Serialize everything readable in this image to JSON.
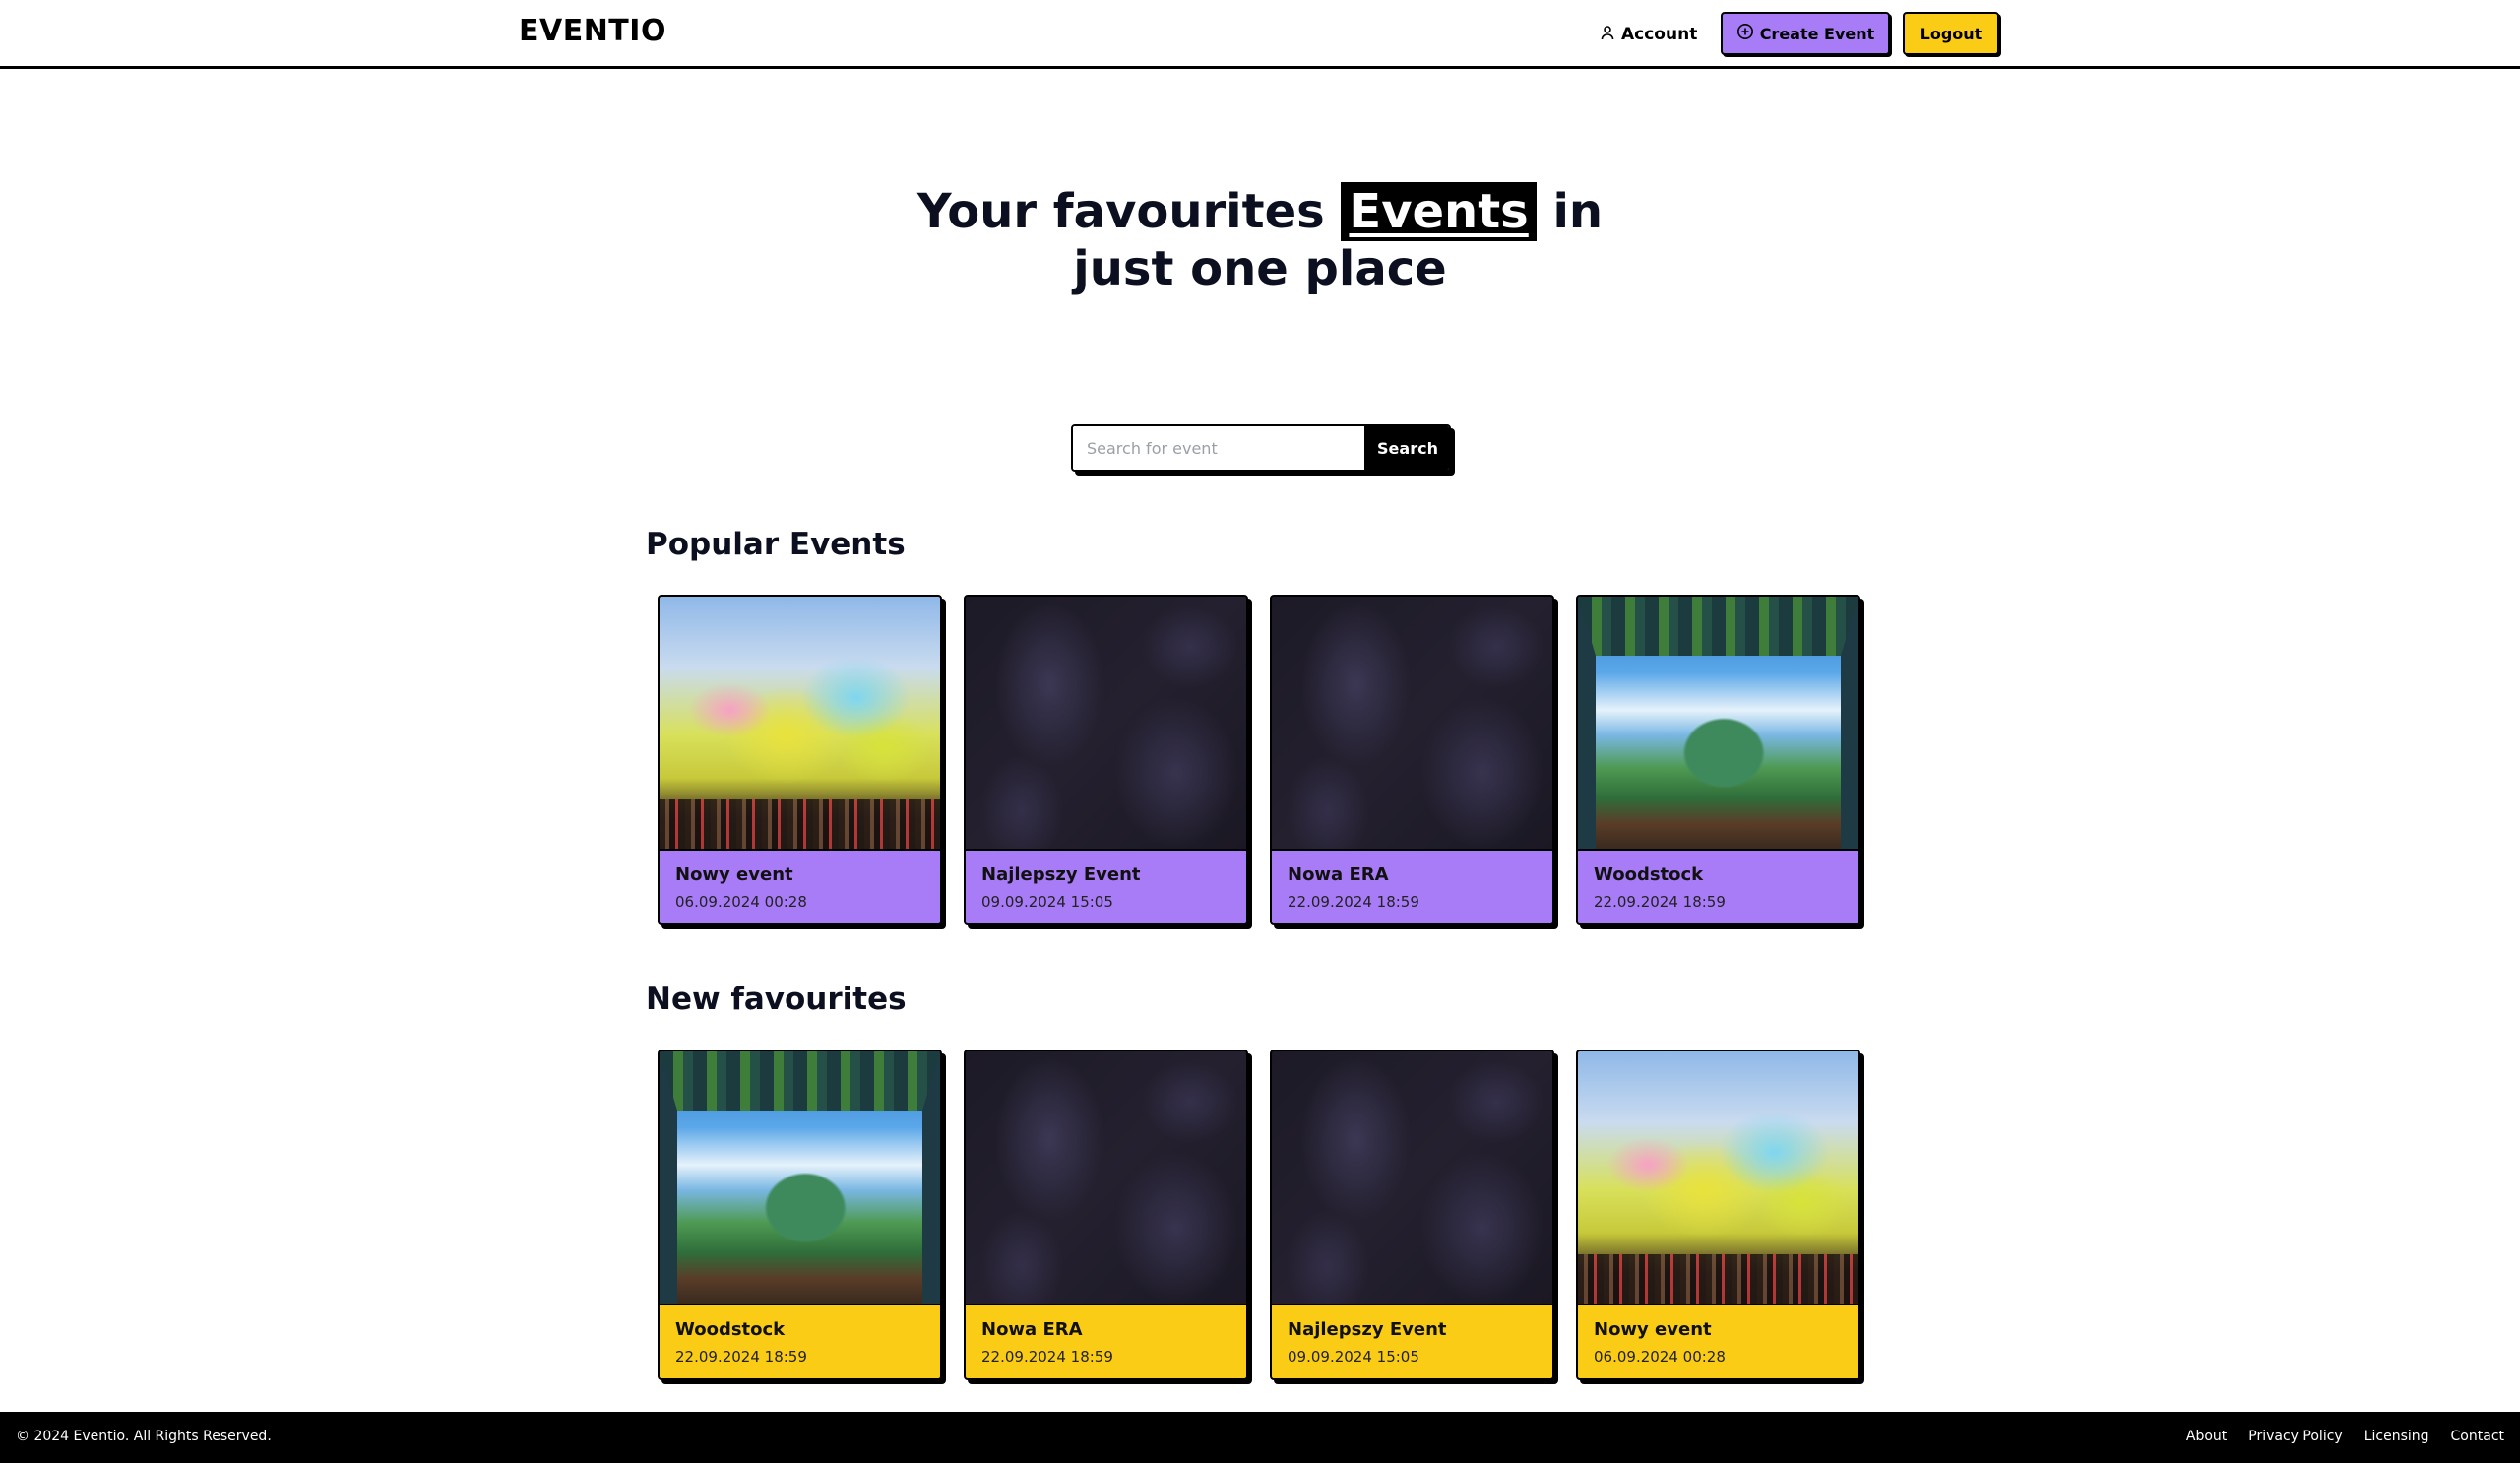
{
  "header": {
    "brand": "EVENTIO",
    "account_label": "Account",
    "create_label": "Create Event",
    "logout_label": "Logout"
  },
  "hero": {
    "before": "Your favourites",
    "highlight": "Events",
    "after": "in",
    "line2": "just one place"
  },
  "search": {
    "placeholder": "Search for event",
    "button_label": "Search"
  },
  "popular": {
    "title": "Popular Events",
    "cards": [
      {
        "title": "Nowy event",
        "date": "06.09.2024 00:28",
        "image": "festival-crowd"
      },
      {
        "title": "Najlepszy Event",
        "date": "09.09.2024 15:05",
        "image": "dark-pattern"
      },
      {
        "title": "Nowa ERA",
        "date": "22.09.2024 18:59",
        "image": "dark-pattern"
      },
      {
        "title": "Woodstock",
        "date": "22.09.2024 18:59",
        "image": "window-landscape"
      }
    ]
  },
  "favourites": {
    "title": "New favourites",
    "cards": [
      {
        "title": "Woodstock",
        "date": "22.09.2024 18:59",
        "image": "window-landscape"
      },
      {
        "title": "Nowa ERA",
        "date": "22.09.2024 18:59",
        "image": "dark-pattern"
      },
      {
        "title": "Najlepszy Event",
        "date": "09.09.2024 15:05",
        "image": "dark-pattern"
      },
      {
        "title": "Nowy event",
        "date": "06.09.2024 00:28",
        "image": "festival-crowd"
      }
    ]
  },
  "footer": {
    "copyright": "© 2024 Eventio. All Rights Reserved.",
    "links": [
      "About",
      "Privacy Policy",
      "Licensing",
      "Contact"
    ]
  },
  "colors": {
    "purple": "#a87bf7",
    "yellow": "#facc15",
    "black": "#000000"
  },
  "icons": {
    "account": "user-icon",
    "create": "plus-circle-icon"
  }
}
